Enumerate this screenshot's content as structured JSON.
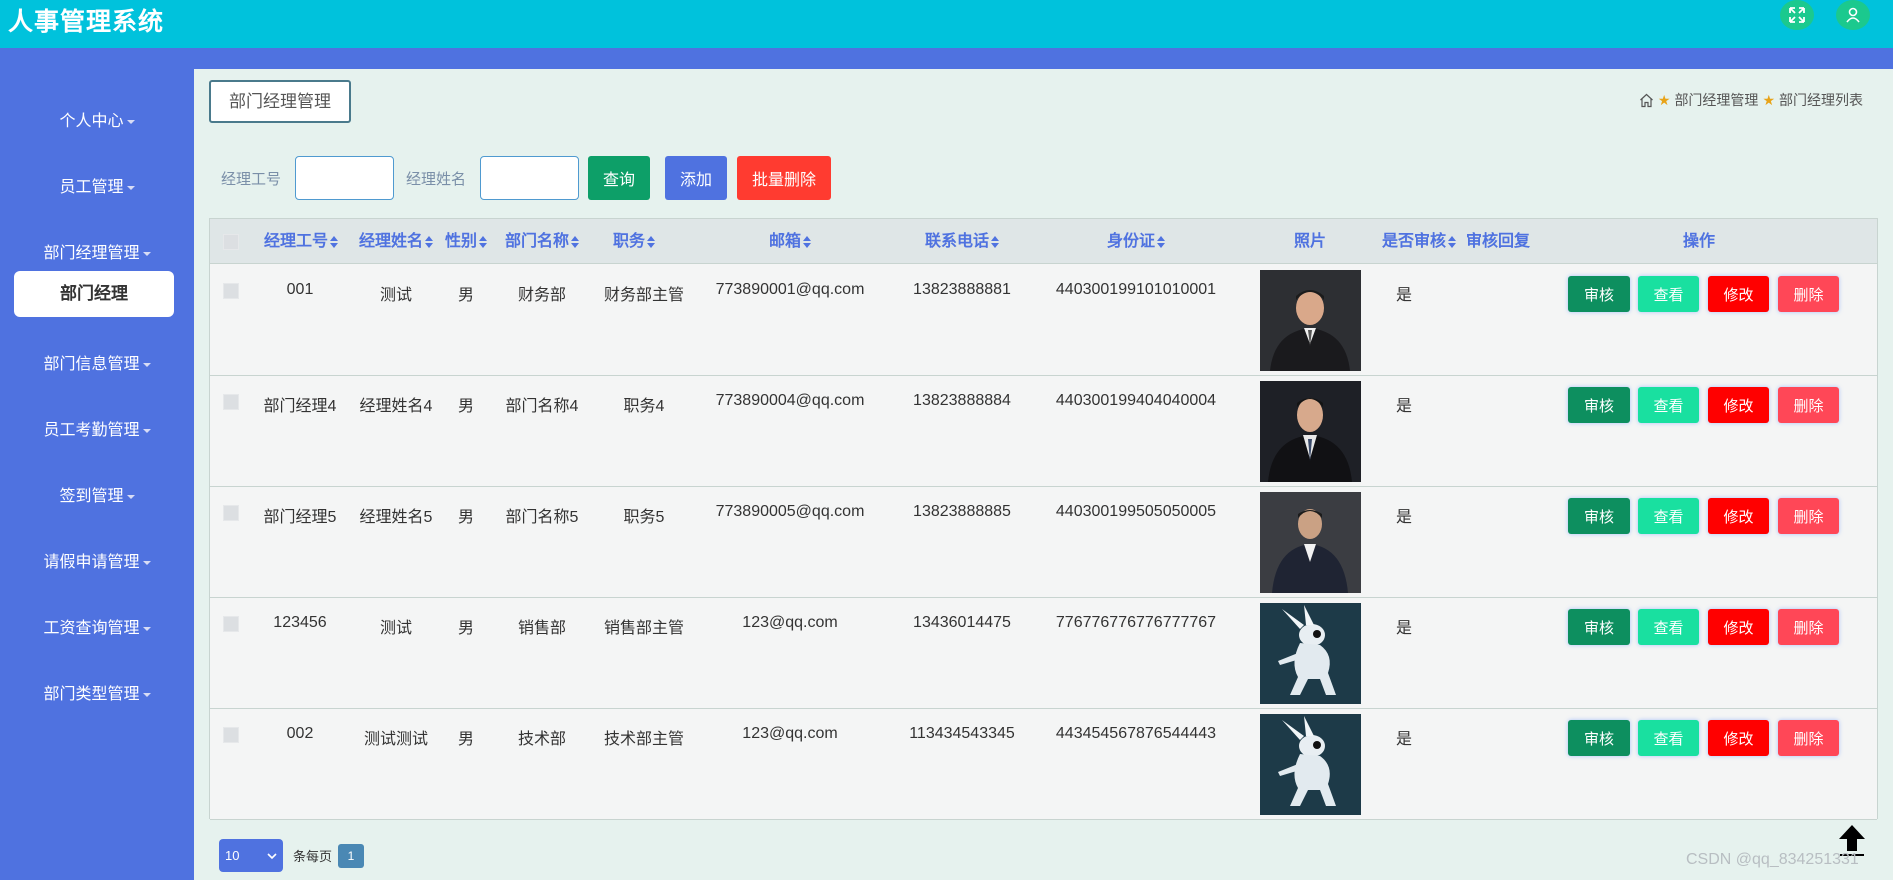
{
  "app": {
    "title": "人事管理系统",
    "icons": {
      "fullscreen": "fullscreen-icon",
      "user": "user-icon"
    }
  },
  "sidebar": {
    "items": [
      {
        "label": "个人中心"
      },
      {
        "label": "员工管理"
      },
      {
        "label": "部门经理管理"
      },
      {
        "label": "部门信息管理"
      },
      {
        "label": "员工考勤管理"
      },
      {
        "label": "签到管理"
      },
      {
        "label": "请假申请管理"
      },
      {
        "label": "工资查询管理"
      },
      {
        "label": "部门类型管理"
      }
    ],
    "active_sub": "部门经理"
  },
  "page": {
    "tag": "部门经理管理",
    "breadcrumb": [
      "部门经理管理",
      "部门经理列表"
    ]
  },
  "search": {
    "label_id": "经理工号",
    "value_id": "",
    "label_name": "经理姓名",
    "value_name": "",
    "query": "查询",
    "add": "添加",
    "batch_delete": "批量删除"
  },
  "table": {
    "headers": [
      "经理工号",
      "经理姓名",
      "性别",
      "部门名称",
      "职务",
      "邮箱",
      "联系电话",
      "身份证",
      "照片",
      "是否审核",
      "审核回复",
      "操作"
    ],
    "rows": [
      {
        "id": "001",
        "name": "测试",
        "gender": "男",
        "dept": "财务部",
        "position": "财务部主管",
        "email": "773890001@qq.com",
        "phone": "13823888881",
        "idcard": "440300199101010001",
        "photo": "man-photo",
        "audited": "是",
        "reply": ""
      },
      {
        "id": "部门经理4",
        "name": "经理姓名4",
        "gender": "男",
        "dept": "部门名称4",
        "position": "职务4",
        "email": "773890004@qq.com",
        "phone": "13823888884",
        "idcard": "440300199404040004",
        "photo": "man-photo",
        "audited": "是",
        "reply": ""
      },
      {
        "id": "部门经理5",
        "name": "经理姓名5",
        "gender": "男",
        "dept": "部门名称5",
        "position": "职务5",
        "email": "773890005@qq.com",
        "phone": "13823888885",
        "idcard": "440300199505050005",
        "photo": "man-photo",
        "audited": "是",
        "reply": ""
      },
      {
        "id": "123456",
        "name": "测试",
        "gender": "男",
        "dept": "销售部",
        "position": "销售部主管",
        "email": "123@qq.com",
        "phone": "13436014475",
        "idcard": "776776776776777767",
        "photo": "rabbit-photo",
        "audited": "是",
        "reply": ""
      },
      {
        "id": "002",
        "name": "测试测试",
        "gender": "男",
        "dept": "技术部",
        "position": "技术部主管",
        "email": "123@qq.com",
        "phone": "113434543345",
        "idcard": "443454567876544443",
        "photo": "rabbit-photo",
        "audited": "是",
        "reply": ""
      }
    ],
    "actions": {
      "audit": "审核",
      "view": "查看",
      "edit": "修改",
      "delete": "删除"
    }
  },
  "pagination": {
    "page_size": "10",
    "per_page_label": "条每页",
    "current": "1"
  },
  "watermark": "CSDN @qq_834251331"
}
